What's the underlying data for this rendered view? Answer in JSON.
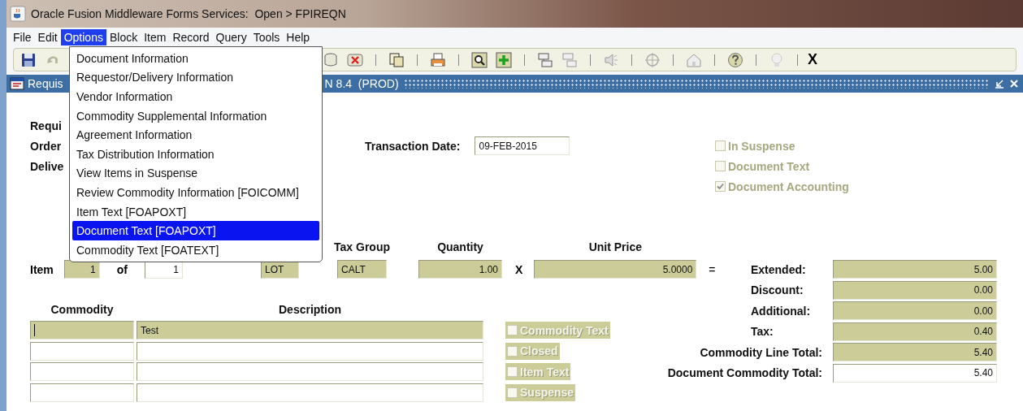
{
  "window": {
    "title": "Oracle Fusion Middleware Forms Services:  Open > FPIREQN"
  },
  "menu_bar": [
    {
      "label": "File",
      "selected": false
    },
    {
      "label": "Edit",
      "selected": false
    },
    {
      "label": "Options",
      "selected": true
    },
    {
      "label": "Block",
      "selected": false
    },
    {
      "label": "Item",
      "selected": false
    },
    {
      "label": "Record",
      "selected": false
    },
    {
      "label": "Query",
      "selected": false
    },
    {
      "label": "Tools",
      "selected": false
    },
    {
      "label": "Help",
      "selected": false
    }
  ],
  "open_menu": {
    "items": [
      {
        "label": "Document Information",
        "selected": false
      },
      {
        "label": "Requestor/Delivery Information",
        "selected": false
      },
      {
        "label": "Vendor Information",
        "selected": false
      },
      {
        "label": "Commodity Supplemental Information",
        "selected": false
      },
      {
        "label": "Agreement Information",
        "selected": false
      },
      {
        "label": "Tax Distribution Information",
        "selected": false
      },
      {
        "label": "View Items in Suspense",
        "selected": false
      },
      {
        "label": "Review Commodity Information [FOICOMM]",
        "selected": false
      },
      {
        "label": "Item Text [FOAPOXT]",
        "selected": false
      },
      {
        "label": "Document Text [FOAPOXT]",
        "selected": true
      },
      {
        "label": "Commodity Text [FOATEXT]",
        "selected": false
      }
    ]
  },
  "toolbar": {
    "exit_label": "X"
  },
  "form_window": {
    "title_start": "Requis",
    "title_end": "N 8.4  (PROD)"
  },
  "header": {
    "labels": [
      "Requi",
      "Order",
      "Delive"
    ],
    "transaction_date": {
      "label": "Transaction Date:",
      "value": "09-FEB-2015"
    },
    "flags": [
      {
        "label": "In Suspense",
        "checked": false,
        "disabled": true
      },
      {
        "label": "Document Text",
        "checked": false,
        "disabled": true
      },
      {
        "label": "Document Accounting",
        "checked": true,
        "disabled": true
      }
    ]
  },
  "item": {
    "label": "Item",
    "number": "1",
    "of_label": "of",
    "count": "1",
    "unit": "LOT",
    "tax_group_header": "Tax Group",
    "tax_group": "CALT",
    "quantity_header": "Quantity",
    "quantity": "1.00",
    "times": "X",
    "unit_price_header": "Unit Price",
    "unit_price": "5.0000",
    "equals": "="
  },
  "totals": [
    {
      "label": "Extended:",
      "value": "5.00",
      "editable": false
    },
    {
      "label": "Discount:",
      "value": "0.00",
      "editable": false
    },
    {
      "label": "Additional:",
      "value": "0.00",
      "editable": false
    },
    {
      "label": "Tax:",
      "value": "0.40",
      "editable": false
    },
    {
      "label": "Commodity Line Total:",
      "value": "5.40",
      "editable": false
    },
    {
      "label": "Document Commodity Total:",
      "value": "5.40",
      "editable": true
    }
  ],
  "commodities": {
    "columns": [
      "Commodity",
      "Description"
    ],
    "rows": [
      {
        "description": "Test",
        "current": true
      },
      {
        "current": false
      },
      {
        "current": false
      },
      {
        "current": false
      }
    ]
  },
  "line_flags": [
    {
      "label": "Commodity Text",
      "checked": false,
      "disabled": true
    },
    {
      "label": "Closed",
      "checked": false,
      "disabled": true
    },
    {
      "label": "Item Text",
      "checked": false,
      "disabled": true
    },
    {
      "label": "Suspense",
      "checked": false,
      "disabled": true
    }
  ]
}
